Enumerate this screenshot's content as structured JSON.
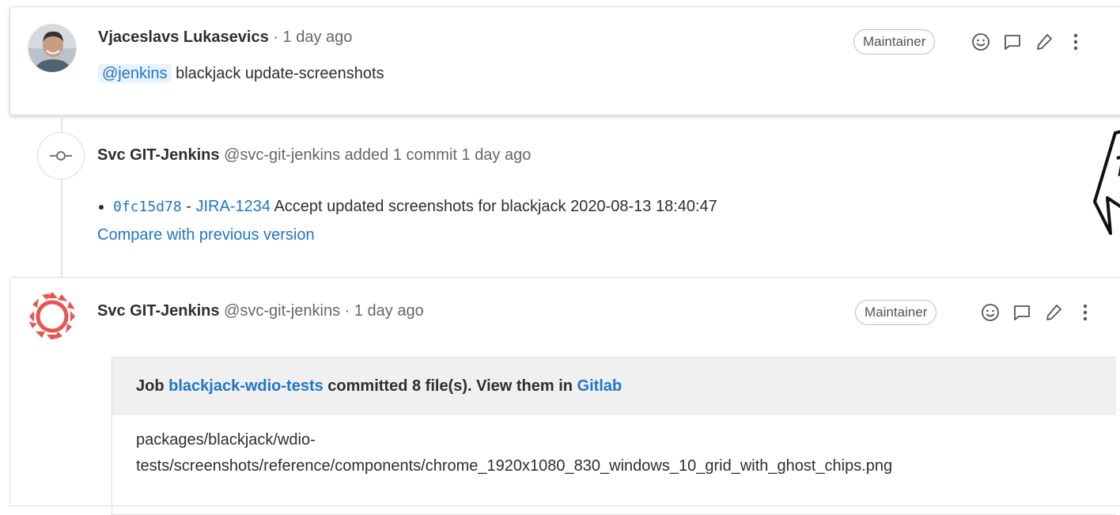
{
  "note1": {
    "author": "Vjaceslavs Lukasevics",
    "separator": " · ",
    "time": "1 day ago",
    "role": "Maintainer",
    "mention": "@jenkins",
    "body_text": " blackjack update-screenshots"
  },
  "system_note": {
    "author": "Svc GIT-Jenkins",
    "handle": "@svc-git-jenkins",
    "action": "added 1 commit 1 day ago",
    "commit": {
      "sha": "0fc15d78",
      "dash": " - ",
      "ticket": "JIRA-1234",
      "message": " Accept updated screenshots for blackjack 2020-08-13 18:40:47"
    },
    "compare_link": "Compare with previous version"
  },
  "note2": {
    "author": "Svc GIT-Jenkins",
    "handle": "@svc-git-jenkins",
    "separator": " · ",
    "time": "1 day ago",
    "role": "Maintainer",
    "job": {
      "prefix": "Job ",
      "job_name": "blackjack-wdio-tests",
      "middle": " committed 8 file(s). View them in ",
      "gitlab_link": "Gitlab",
      "file_line1": "packages/blackjack/wdio-",
      "file_line2": "tests/screenshots/reference/components/chrome_1920x1080_830_windows_10_grid_with_ghost_chips.png"
    }
  },
  "icons": {
    "emoji": "smiley-icon",
    "reply": "comment-icon",
    "edit": "pencil-icon",
    "more": "kebab-icon",
    "commit": "commit-icon"
  },
  "colors": {
    "link": "#1f75cb",
    "mention_bg": "#e9f3fc",
    "avatar_bot": "#e8544f"
  }
}
